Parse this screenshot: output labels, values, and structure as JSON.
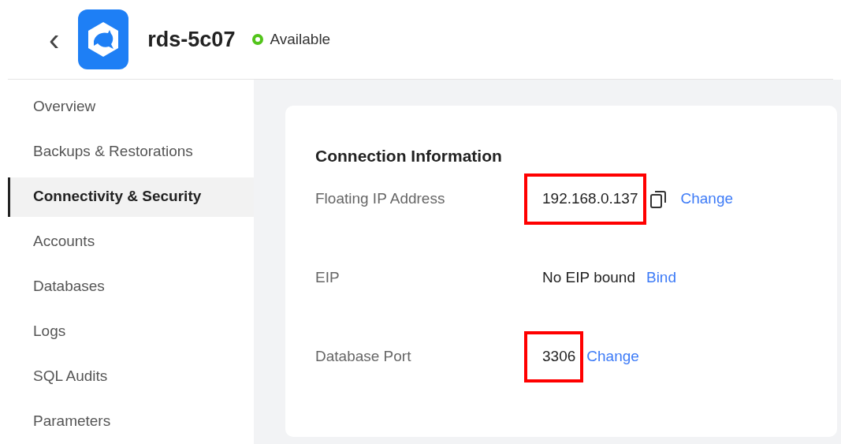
{
  "header": {
    "back": "‹",
    "title": "rds-5c07",
    "status": {
      "label": "Available",
      "color": "#52c41a"
    }
  },
  "sidebar": {
    "items": [
      {
        "label": "Overview",
        "selected": false
      },
      {
        "label": "Backups & Restorations",
        "selected": false
      },
      {
        "label": "Connectivity & Security",
        "selected": true
      },
      {
        "label": "Accounts",
        "selected": false
      },
      {
        "label": "Databases",
        "selected": false
      },
      {
        "label": "Logs",
        "selected": false
      },
      {
        "label": "SQL Audits",
        "selected": false
      },
      {
        "label": "Parameters",
        "selected": false
      }
    ]
  },
  "card": {
    "title": "Connection Information",
    "rows": [
      {
        "label": "Floating IP Address",
        "value": "192.168.0.137",
        "highlighted": true,
        "copyable": true,
        "action": "Change"
      },
      {
        "label": "EIP",
        "value": "No EIP bound",
        "highlighted": false,
        "copyable": false,
        "action": "Bind"
      },
      {
        "label": "Database Port",
        "value": "3306",
        "highlighted": true,
        "copyable": false,
        "action": "Change"
      }
    ]
  }
}
